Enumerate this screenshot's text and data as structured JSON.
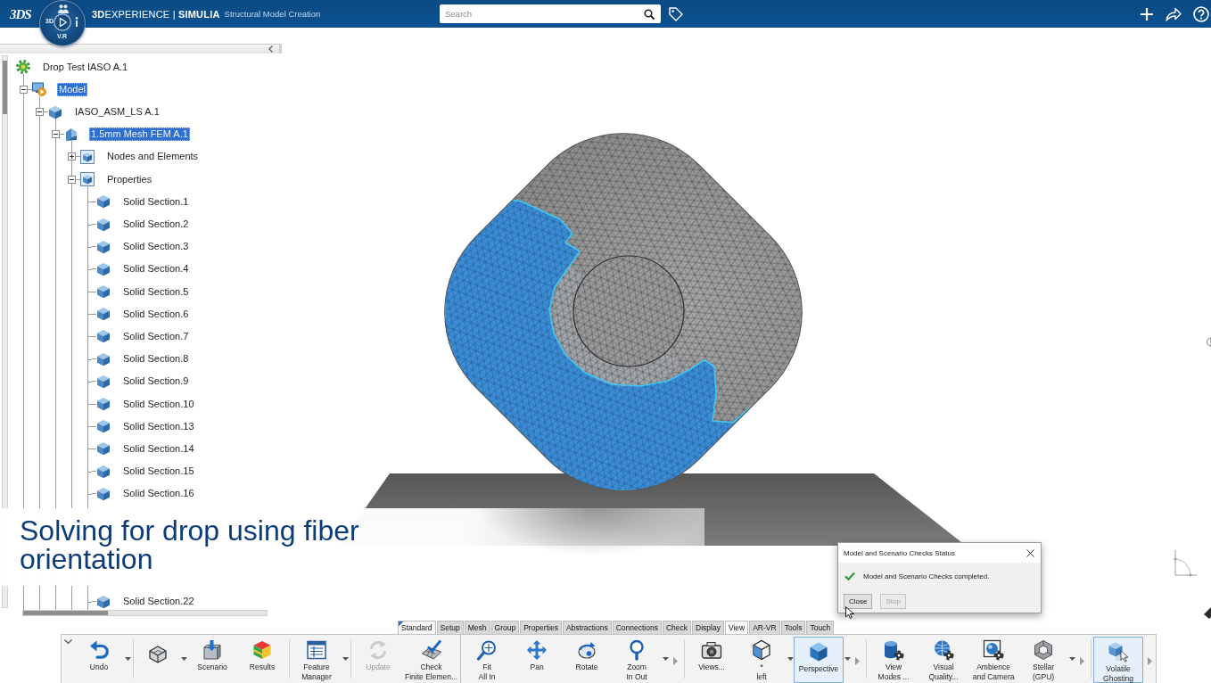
{
  "top_bar": {
    "logo": "3DS",
    "compass": {
      "left_label": "3D",
      "bottom_label": "V.R"
    },
    "brand": "**3D**EXPERIENCE | **SIMULIA**",
    "app": "Structural Model Creation",
    "search": {
      "placeholder": "Search"
    }
  },
  "tree": [
    {
      "label": "Drop Test IASO A.1",
      "kind": "analysis",
      "selected": false,
      "children": [
        {
          "label": "Model",
          "kind": "model",
          "selected": true,
          "expanded": true,
          "children": [
            {
              "label": "IASO_ASM_LS A.1",
              "kind": "product",
              "selected": false,
              "expanded": true,
              "children": [
                {
                  "label": "1.5mm Mesh FEM A.1",
                  "kind": "mesh",
                  "selected": true,
                  "expanded": true,
                  "children": [
                    {
                      "label": "Nodes and Elements",
                      "kind": "folder",
                      "selected": false,
                      "expanded": false
                    },
                    {
                      "label": "Properties",
                      "kind": "folder",
                      "selected": false,
                      "expanded": true,
                      "children": [
                        {
                          "label": "Solid Section.1",
                          "kind": "section",
                          "selected": false
                        },
                        {
                          "label": "Solid Section.2",
                          "kind": "section",
                          "selected": false
                        },
                        {
                          "label": "Solid Section.3",
                          "kind": "section",
                          "selected": false
                        },
                        {
                          "label": "Solid Section.4",
                          "kind": "section",
                          "selected": false
                        },
                        {
                          "label": "Solid Section.5",
                          "kind": "section",
                          "selected": false
                        },
                        {
                          "label": "Solid Section.6",
                          "kind": "section",
                          "selected": false
                        },
                        {
                          "label": "Solid Section.7",
                          "kind": "section",
                          "selected": false
                        },
                        {
                          "label": "Solid Section.8",
                          "kind": "section",
                          "selected": false
                        },
                        {
                          "label": "Solid Section.9",
                          "kind": "section",
                          "selected": false
                        },
                        {
                          "label": "Solid Section.10",
                          "kind": "section",
                          "selected": false
                        },
                        {
                          "label": "Solid Section.13",
                          "kind": "section",
                          "selected": false
                        },
                        {
                          "label": "Solid Section.14",
                          "kind": "section",
                          "selected": false
                        },
                        {
                          "label": "Solid Section.15",
                          "kind": "section",
                          "selected": false
                        },
                        {
                          "label": "Solid Section.16",
                          "kind": "section",
                          "selected": false
                        },
                        {
                          "label": "Solid Section.22",
                          "kind": "section",
                          "selected": false
                        }
                      ]
                    }
                  ]
                }
              ]
            }
          ]
        }
      ]
    }
  ],
  "caption": "Solving for drop using fiber orientation",
  "dialog": {
    "title": "Model and Scenario Checks Status",
    "message": "Model and Scenario Checks completed.",
    "buttons": [
      {
        "label": "Close",
        "disabled": false
      },
      {
        "label": "Stop",
        "disabled": true
      }
    ]
  },
  "action_bar": {
    "tabs": [
      {
        "label": "Standard",
        "selected": true,
        "pinned": true
      },
      {
        "label": "Setup",
        "selected": false,
        "pinned": false
      },
      {
        "label": "Mesh",
        "selected": false,
        "pinned": false
      },
      {
        "label": "Group",
        "selected": false,
        "pinned": false
      },
      {
        "label": "Properties",
        "selected": false,
        "pinned": false
      },
      {
        "label": "Abstractions",
        "selected": false,
        "pinned": false
      },
      {
        "label": "Connections",
        "selected": false,
        "pinned": false
      },
      {
        "label": "Check",
        "selected": false,
        "pinned": false
      },
      {
        "label": "Display",
        "selected": false,
        "pinned": false
      },
      {
        "label": "View",
        "selected": true,
        "pinned": false
      },
      {
        "label": "AR-VR",
        "selected": false,
        "pinned": false
      },
      {
        "label": "Tools",
        "selected": false,
        "pinned": false
      },
      {
        "label": "Touch",
        "selected": false,
        "pinned": false
      }
    ],
    "commands": [
      {
        "kind": "command",
        "label": "Undo",
        "dropdown": true,
        "selected": false,
        "disabled": false
      },
      {
        "kind": "separator"
      },
      {
        "kind": "command",
        "dropdown": true,
        "selected": false,
        "disabled": false
      },
      {
        "kind": "command",
        "label": "Scenario",
        "dropdown": false,
        "selected": false,
        "disabled": false
      },
      {
        "kind": "command",
        "label": "Results",
        "dropdown": false,
        "selected": false,
        "disabled": false
      },
      {
        "kind": "separator"
      },
      {
        "kind": "command",
        "label": "Feature\nManager",
        "dropdown": true,
        "selected": false,
        "disabled": false
      },
      {
        "kind": "separator"
      },
      {
        "kind": "command",
        "label": "Update",
        "dropdown": false,
        "selected": false,
        "disabled": true
      },
      {
        "kind": "command",
        "label": "Check\nFinite Elemen...",
        "dropdown": false,
        "selected": false,
        "disabled": false
      },
      {
        "kind": "section"
      },
      {
        "kind": "command",
        "label": "Fit\nAll In",
        "dropdown": false,
        "selected": false,
        "disabled": false
      },
      {
        "kind": "command",
        "label": "Pan",
        "dropdown": false,
        "selected": false,
        "disabled": false
      },
      {
        "kind": "command",
        "label": "Rotate",
        "dropdown": false,
        "selected": false,
        "disabled": false
      },
      {
        "kind": "command",
        "label": "Zoom\nIn Out",
        "dropdown": true,
        "selected": false,
        "disabled": false
      },
      {
        "kind": "more"
      },
      {
        "kind": "separator"
      },
      {
        "kind": "command",
        "label": "Views...",
        "dropdown": false,
        "selected": false,
        "disabled": false
      },
      {
        "kind": "command",
        "label": "*\nleft",
        "dropdown": true,
        "selected": false,
        "disabled": false
      },
      {
        "kind": "command",
        "label": "Perspective",
        "dropdown": true,
        "selected": true,
        "disabled": false
      },
      {
        "kind": "more"
      },
      {
        "kind": "separator"
      },
      {
        "kind": "command",
        "label": "View\nModes ...",
        "dropdown": false,
        "selected": false,
        "disabled": false
      },
      {
        "kind": "command",
        "label": "Visual\nQuality...",
        "dropdown": false,
        "selected": false,
        "disabled": false
      },
      {
        "kind": "command",
        "label": "Ambience\nand Camera",
        "dropdown": false,
        "selected": false,
        "disabled": false
      },
      {
        "kind": "command",
        "label": "Stellar\n(GPU)",
        "dropdown": true,
        "selected": false,
        "disabled": false
      },
      {
        "kind": "more"
      },
      {
        "kind": "separator"
      },
      {
        "kind": "command",
        "label": "Volatile\nGhosting",
        "dropdown": false,
        "selected": true,
        "disabled": false
      },
      {
        "kind": "more"
      }
    ]
  }
}
